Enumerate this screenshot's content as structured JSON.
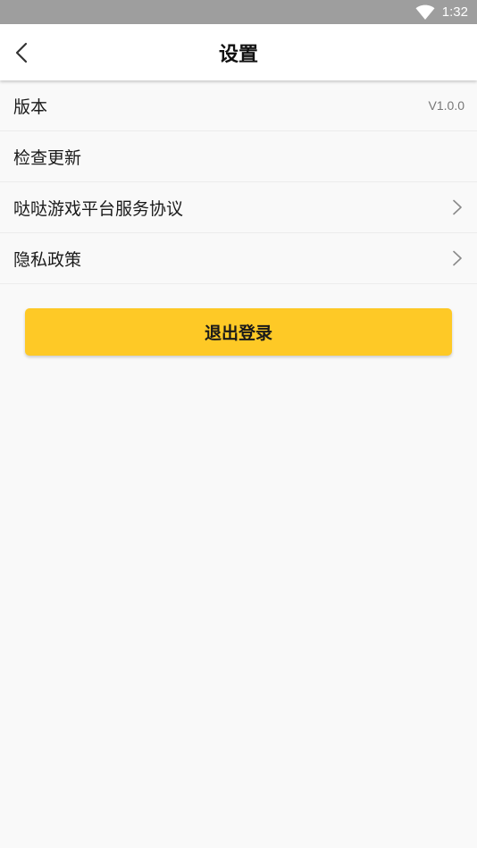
{
  "status_bar": {
    "time": "1:32",
    "wifi_icon": "wifi-icon"
  },
  "header": {
    "title": "设置",
    "back_icon": "chevron-left-icon"
  },
  "settings": {
    "items": [
      {
        "label": "版本",
        "value": "V1.0.0"
      },
      {
        "label": "检查更新"
      },
      {
        "label": "哒哒游戏平台服务协议",
        "icon": "chevron-right-icon"
      },
      {
        "label": "隐私政策",
        "icon": "chevron-right-icon"
      }
    ]
  },
  "logout": {
    "label": "退出登录",
    "color": "#fec926"
  },
  "colors": {
    "status_bar": "#9e9e9e",
    "background": "#f9f9f9",
    "accent": "#fec926"
  }
}
